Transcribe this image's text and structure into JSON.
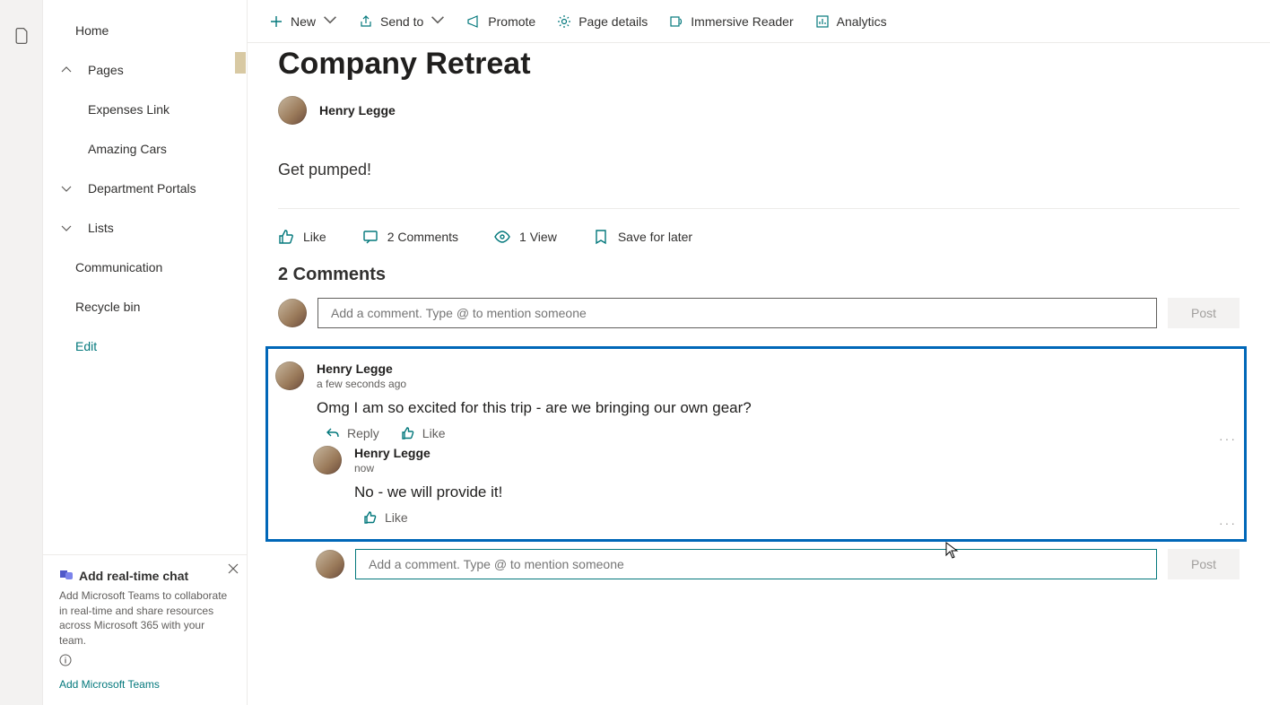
{
  "colors": {
    "accent": "#03787c",
    "highlight": "#0067b8"
  },
  "sidebar": {
    "items": [
      {
        "label": "Home",
        "type": "link"
      },
      {
        "label": "Pages",
        "type": "group-open"
      },
      {
        "label": "Expenses Link",
        "type": "sub"
      },
      {
        "label": "Amazing Cars",
        "type": "sub"
      },
      {
        "label": "Department Portals",
        "type": "group"
      },
      {
        "label": "Lists",
        "type": "group"
      },
      {
        "label": "Communication",
        "type": "sub2"
      },
      {
        "label": "Recycle bin",
        "type": "sub2"
      },
      {
        "label": "Edit",
        "type": "edit"
      }
    ],
    "promo": {
      "title": "Add real-time chat",
      "desc": "Add Microsoft Teams to collaborate in real-time and share resources across Microsoft 365 with your team.",
      "link": "Add Microsoft Teams"
    }
  },
  "toolbar": [
    {
      "label": "New",
      "icon": "plus",
      "chevron": true
    },
    {
      "label": "Send to",
      "icon": "share",
      "chevron": true
    },
    {
      "label": "Promote",
      "icon": "megaphone"
    },
    {
      "label": "Page details",
      "icon": "gear"
    },
    {
      "label": "Immersive Reader",
      "icon": "reader"
    },
    {
      "label": "Analytics",
      "icon": "chart"
    }
  ],
  "page": {
    "title": "Company Retreat",
    "author": "Henry Legge",
    "body": "Get pumped!",
    "actions": {
      "like": "Like",
      "comments": "2 Comments",
      "views": "1 View",
      "save": "Save for later"
    },
    "comments_heading": "2 Comments",
    "comment_placeholder": "Add a comment. Type @ to mention someone",
    "post_label": "Post",
    "reply_label": "Reply",
    "like_label": "Like"
  },
  "comments": [
    {
      "author": "Henry Legge",
      "time": "a few seconds ago",
      "text": "Omg I am so excited for this trip - are we bringing our own gear?"
    },
    {
      "author": "Henry Legge",
      "time": "now",
      "text": "No - we will provide it!"
    }
  ]
}
